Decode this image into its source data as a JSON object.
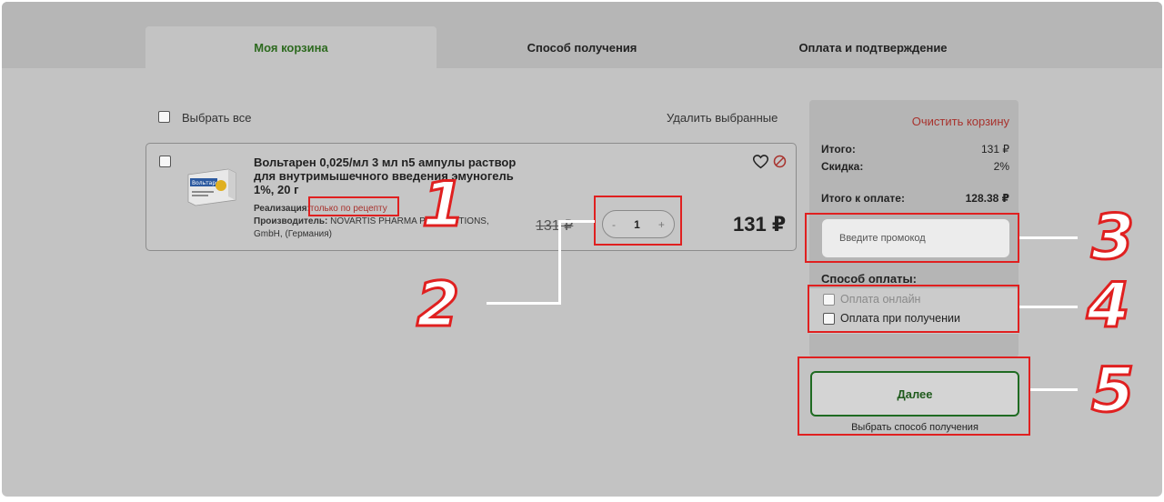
{
  "tabs": [
    {
      "label": "Моя корзина",
      "active": true
    },
    {
      "label": "Способ получения",
      "active": false
    },
    {
      "label": "Оплата и подтверждение",
      "active": false
    }
  ],
  "cart": {
    "select_all_label": "Выбрать все",
    "delete_selected_label": "Удалить выбранные"
  },
  "product": {
    "title": "Вольтарен 0,025/мл 3 мл n5 ампулы раствор для внутримышечного введения эмуногель 1%, 20 г",
    "image_label": "Вольтарен",
    "sale_label": "Реализация:",
    "sale_value": "только по рецепту",
    "manufacturer_label": "Производитель:",
    "manufacturer_value": "NOVARTIS PHARMA PRODUCTIONS, GmbH, (Германия)",
    "old_price": "131 ₽",
    "quantity": "1",
    "minus": "-",
    "plus": "+",
    "price": "131 ₽"
  },
  "summary": {
    "clear_cart_label": "Очистить корзину",
    "total_label": "Итого:",
    "total_value": "131 ₽",
    "discount_label": "Скидка:",
    "discount_value": "2%",
    "to_pay_label": "Итого к оплате:",
    "to_pay_value": "128.38 ₽",
    "promo_placeholder": "Введите промокод",
    "payment_method_label": "Способ оплаты:",
    "payment_options": [
      "Оплата онлайн",
      "Оплата при получении"
    ]
  },
  "next": {
    "button_label": "Далее",
    "hint": "Выбрать способ получения"
  },
  "callouts": [
    "1",
    "2",
    "3",
    "4",
    "5"
  ],
  "colors": {
    "accent_green": "#2d6a1f",
    "warning_red": "#a8322d",
    "highlight_red": "#e02020"
  }
}
